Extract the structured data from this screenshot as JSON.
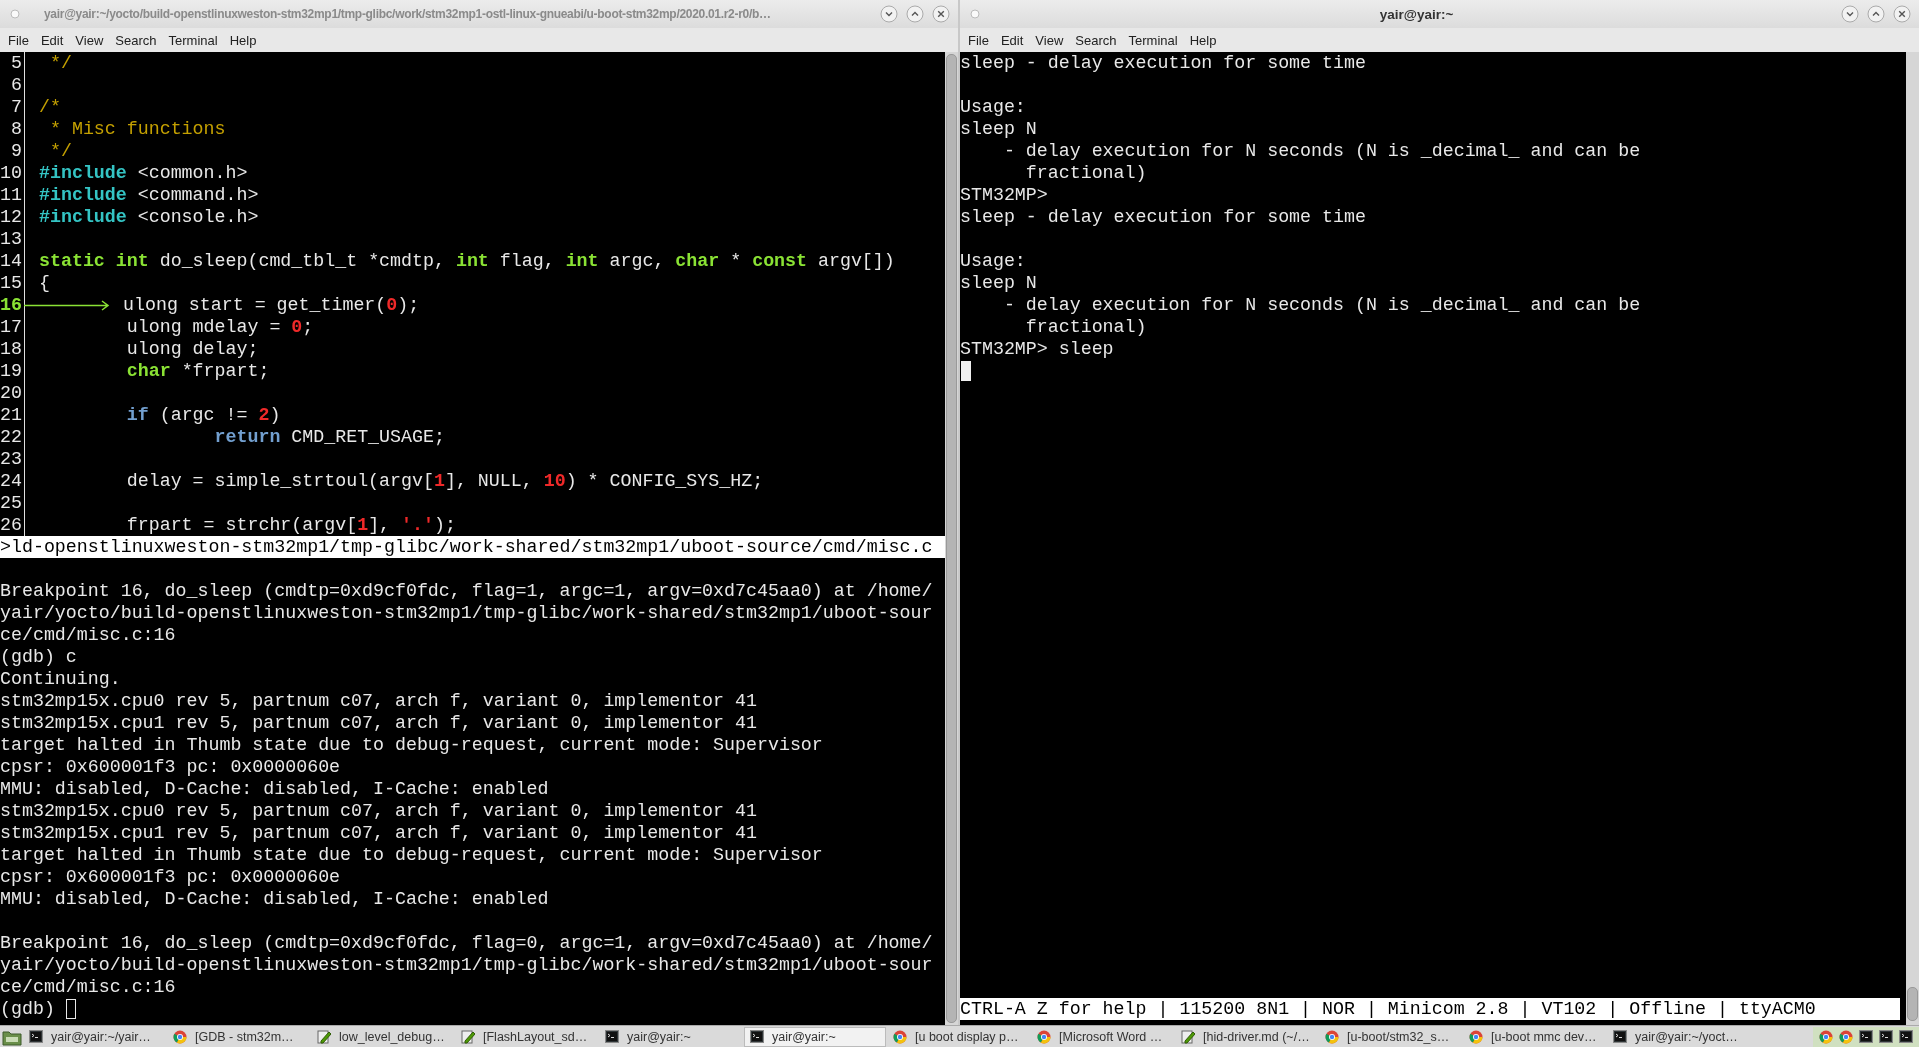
{
  "windows": [
    {
      "title": "yair@yair:~/yocto/build-openstlinuxweston-stm32mp1/tmp-glibc/work/stm32mp1-ostl-linux-gnueabi/u-boot-stm32mp/2020.01.r2-r0/b…",
      "active": false,
      "kind": "gdb",
      "menu": [
        "File",
        "Edit",
        "View",
        "Search",
        "Terminal",
        "Help"
      ],
      "source": {
        "lines": [
          {
            "number": "5",
            "current": false,
            "tokens": [
              {
                "text": " */",
                "kind": "comment"
              }
            ]
          },
          {
            "number": "6",
            "current": false
          },
          {
            "number": "7",
            "current": false,
            "tokens": [
              {
                "text": "/*",
                "kind": "comment"
              }
            ]
          },
          {
            "number": "8",
            "current": false,
            "tokens": [
              {
                "text": " * Misc functions",
                "kind": "comment"
              }
            ]
          },
          {
            "number": "9",
            "current": false,
            "tokens": [
              {
                "text": " */",
                "kind": "comment"
              }
            ]
          },
          {
            "number": "10",
            "current": false,
            "tokens": [
              {
                "text": "#include",
                "kind": "preproc"
              },
              {
                "text": " <common.h>",
                "kind": "plain"
              }
            ]
          },
          {
            "number": "11",
            "current": false,
            "tokens": [
              {
                "text": "#include",
                "kind": "preproc"
              },
              {
                "text": " <command.h>",
                "kind": "plain"
              }
            ]
          },
          {
            "number": "12",
            "current": false,
            "tokens": [
              {
                "text": "#include",
                "kind": "preproc"
              },
              {
                "text": " <console.h>",
                "kind": "plain"
              }
            ]
          },
          {
            "number": "13",
            "current": false
          },
          {
            "number": "14",
            "current": false,
            "tokens": [
              {
                "text": "static int",
                "kind": "type"
              },
              {
                "text": " do_sleep(cmd_tbl_t *cmdtp, ",
                "kind": "plain"
              },
              {
                "text": "int",
                "kind": "type"
              },
              {
                "text": " flag, ",
                "kind": "plain"
              },
              {
                "text": "int",
                "kind": "type"
              },
              {
                "text": " argc, ",
                "kind": "plain"
              },
              {
                "text": "char",
                "kind": "type"
              },
              {
                "text": " * ",
                "kind": "plain"
              },
              {
                "text": "const",
                "kind": "type"
              },
              {
                "text": " argv[])",
                "kind": "plain"
              }
            ]
          },
          {
            "number": "15",
            "current": false,
            "tokens": [
              {
                "text": "{",
                "kind": "plain"
              }
            ]
          },
          {
            "number": "16",
            "current": true,
            "tokens": [
              {
                "text": "ulong start = get_timer(",
                "kind": "plain"
              },
              {
                "text": "0",
                "kind": "number"
              },
              {
                "text": ");",
                "kind": "plain"
              }
            ]
          },
          {
            "number": "17",
            "current": false,
            "tokens": [
              {
                "text": "        ulong mdelay = ",
                "kind": "plain"
              },
              {
                "text": "0",
                "kind": "number"
              },
              {
                "text": ";",
                "kind": "plain"
              }
            ]
          },
          {
            "number": "18",
            "current": false,
            "tokens": [
              {
                "text": "        ulong delay;",
                "kind": "plain"
              }
            ]
          },
          {
            "number": "19",
            "current": false,
            "tokens": [
              {
                "text": "        char",
                "kind": "type"
              },
              {
                "text": " *frpart;",
                "kind": "plain"
              }
            ]
          },
          {
            "number": "20",
            "current": false
          },
          {
            "number": "21",
            "current": false,
            "tokens": [
              {
                "text": "        if",
                "kind": "control"
              },
              {
                "text": " (argc != ",
                "kind": "plain"
              },
              {
                "text": "2",
                "kind": "number"
              },
              {
                "text": ")",
                "kind": "plain"
              }
            ]
          },
          {
            "number": "22",
            "current": false,
            "tokens": [
              {
                "text": "                return",
                "kind": "control"
              },
              {
                "text": " CMD_RET_USAGE;",
                "kind": "plain"
              }
            ]
          },
          {
            "number": "23",
            "current": false
          },
          {
            "number": "24",
            "current": false,
            "tokens": [
              {
                "text": "        delay = simple_strtoul(argv[",
                "kind": "plain"
              },
              {
                "text": "1",
                "kind": "number"
              },
              {
                "text": "], NULL, ",
                "kind": "plain"
              },
              {
                "text": "10",
                "kind": "number"
              },
              {
                "text": ") * CONFIG_SYS_HZ;",
                "kind": "plain"
              }
            ]
          },
          {
            "number": "25",
            "current": false
          },
          {
            "number": "26",
            "current": false,
            "tokens": [
              {
                "text": "        frpart = strchr(argv[",
                "kind": "plain"
              },
              {
                "text": "1",
                "kind": "number"
              },
              {
                "text": "], ",
                "kind": "plain"
              },
              {
                "text": "'.'",
                "kind": "string"
              },
              {
                "text": ");",
                "kind": "plain"
              }
            ]
          }
        ],
        "status": ">ld-openstlinuxweston-stm32mp1/tmp-glibc/work-shared/stm32mp1/uboot-source/cmd/misc.c"
      },
      "output": {
        "blocks": [
          [
            "Breakpoint 16, do_sleep (cmdtp=0xd9cf0fdc, flag=1, argc=1, argv=0xd7c45aa0) at /home/",
            "yair/yocto/build-openstlinuxweston-stm32mp1/tmp-glibc/work-shared/stm32mp1/uboot-sour",
            "ce/cmd/misc.c:16",
            "(gdb) c",
            "Continuing.",
            "stm32mp15x.cpu0 rev 5, partnum c07, arch f, variant 0, implementor 41",
            "stm32mp15x.cpu1 rev 5, partnum c07, arch f, variant 0, implementor 41",
            "target halted in Thumb state due to debug-request, current mode: Supervisor",
            "cpsr: 0x600001f3 pc: 0x0000060e",
            "MMU: disabled, D-Cache: disabled, I-Cache: enabled",
            "stm32mp15x.cpu0 rev 5, partnum c07, arch f, variant 0, implementor 41",
            "stm32mp15x.cpu1 rev 5, partnum c07, arch f, variant 0, implementor 41",
            "target halted in Thumb state due to debug-request, current mode: Supervisor",
            "cpsr: 0x600001f3 pc: 0x0000060e",
            "MMU: disabled, D-Cache: disabled, I-Cache: enabled"
          ],
          [
            "Breakpoint 16, do_sleep (cmdtp=0xd9cf0fdc, flag=0, argc=1, argv=0xd7c45aa0) at /home/",
            "yair/yocto/build-openstlinuxweston-stm32mp1/tmp-glibc/work-shared/stm32mp1/uboot-sour",
            "ce/cmd/misc.c:16",
            "(gdb) "
          ]
        ]
      }
    },
    {
      "title": "yair@yair:~",
      "active": true,
      "kind": "minicom",
      "menu": [
        "File",
        "Edit",
        "View",
        "Search",
        "Terminal",
        "Help"
      ],
      "output": {
        "blocks": [
          [
            "sleep - delay execution for some time"
          ],
          [
            "Usage:",
            "sleep N",
            "    - delay execution for N seconds (N is _decimal_ and can be",
            "      fractional)",
            "STM32MP>",
            "sleep - delay execution for some time"
          ],
          [
            "Usage:",
            "sleep N",
            "    - delay execution for N seconds (N is _decimal_ and can be",
            "      fractional)",
            "STM32MP> sleep"
          ]
        ]
      },
      "status": "CTRL-A Z for help | 115200 8N1 | NOR | Minicom 2.8 | VT102 | Offline | ttyACM0"
    }
  ],
  "taskbar": {
    "items": [
      {
        "kind": "terminal",
        "title": "yair@yair:~/yair…",
        "selected": false
      },
      {
        "kind": "browser",
        "title": "[GDB - stm32m…",
        "selected": false
      },
      {
        "kind": "editor",
        "title": "low_level_debug…",
        "selected": false
      },
      {
        "kind": "editor",
        "title": "[FlashLayout_sd…",
        "selected": false
      },
      {
        "kind": "terminal",
        "title": "yair@yair:~",
        "selected": false
      },
      {
        "kind": "terminal",
        "title": "yair@yair:~",
        "selected": true
      },
      {
        "kind": "browser",
        "title": "[u boot display p…",
        "selected": false
      },
      {
        "kind": "browser",
        "title": "[Microsoft Word …",
        "selected": false
      },
      {
        "kind": "editor",
        "title": "[hid-driver.md (~/…",
        "selected": false
      },
      {
        "kind": "browser",
        "title": "[u-boot/stm32_s…",
        "selected": false
      },
      {
        "kind": "browser",
        "title": "[u-boot mmc dev…",
        "selected": false
      },
      {
        "kind": "terminal",
        "title": "yair@yair:~/yoct…",
        "selected": false
      }
    ],
    "tray": [
      {
        "kind": "browser"
      },
      {
        "kind": "browser"
      },
      {
        "kind": "terminal"
      },
      {
        "kind": "terminal"
      },
      {
        "kind": "terminal"
      }
    ]
  }
}
